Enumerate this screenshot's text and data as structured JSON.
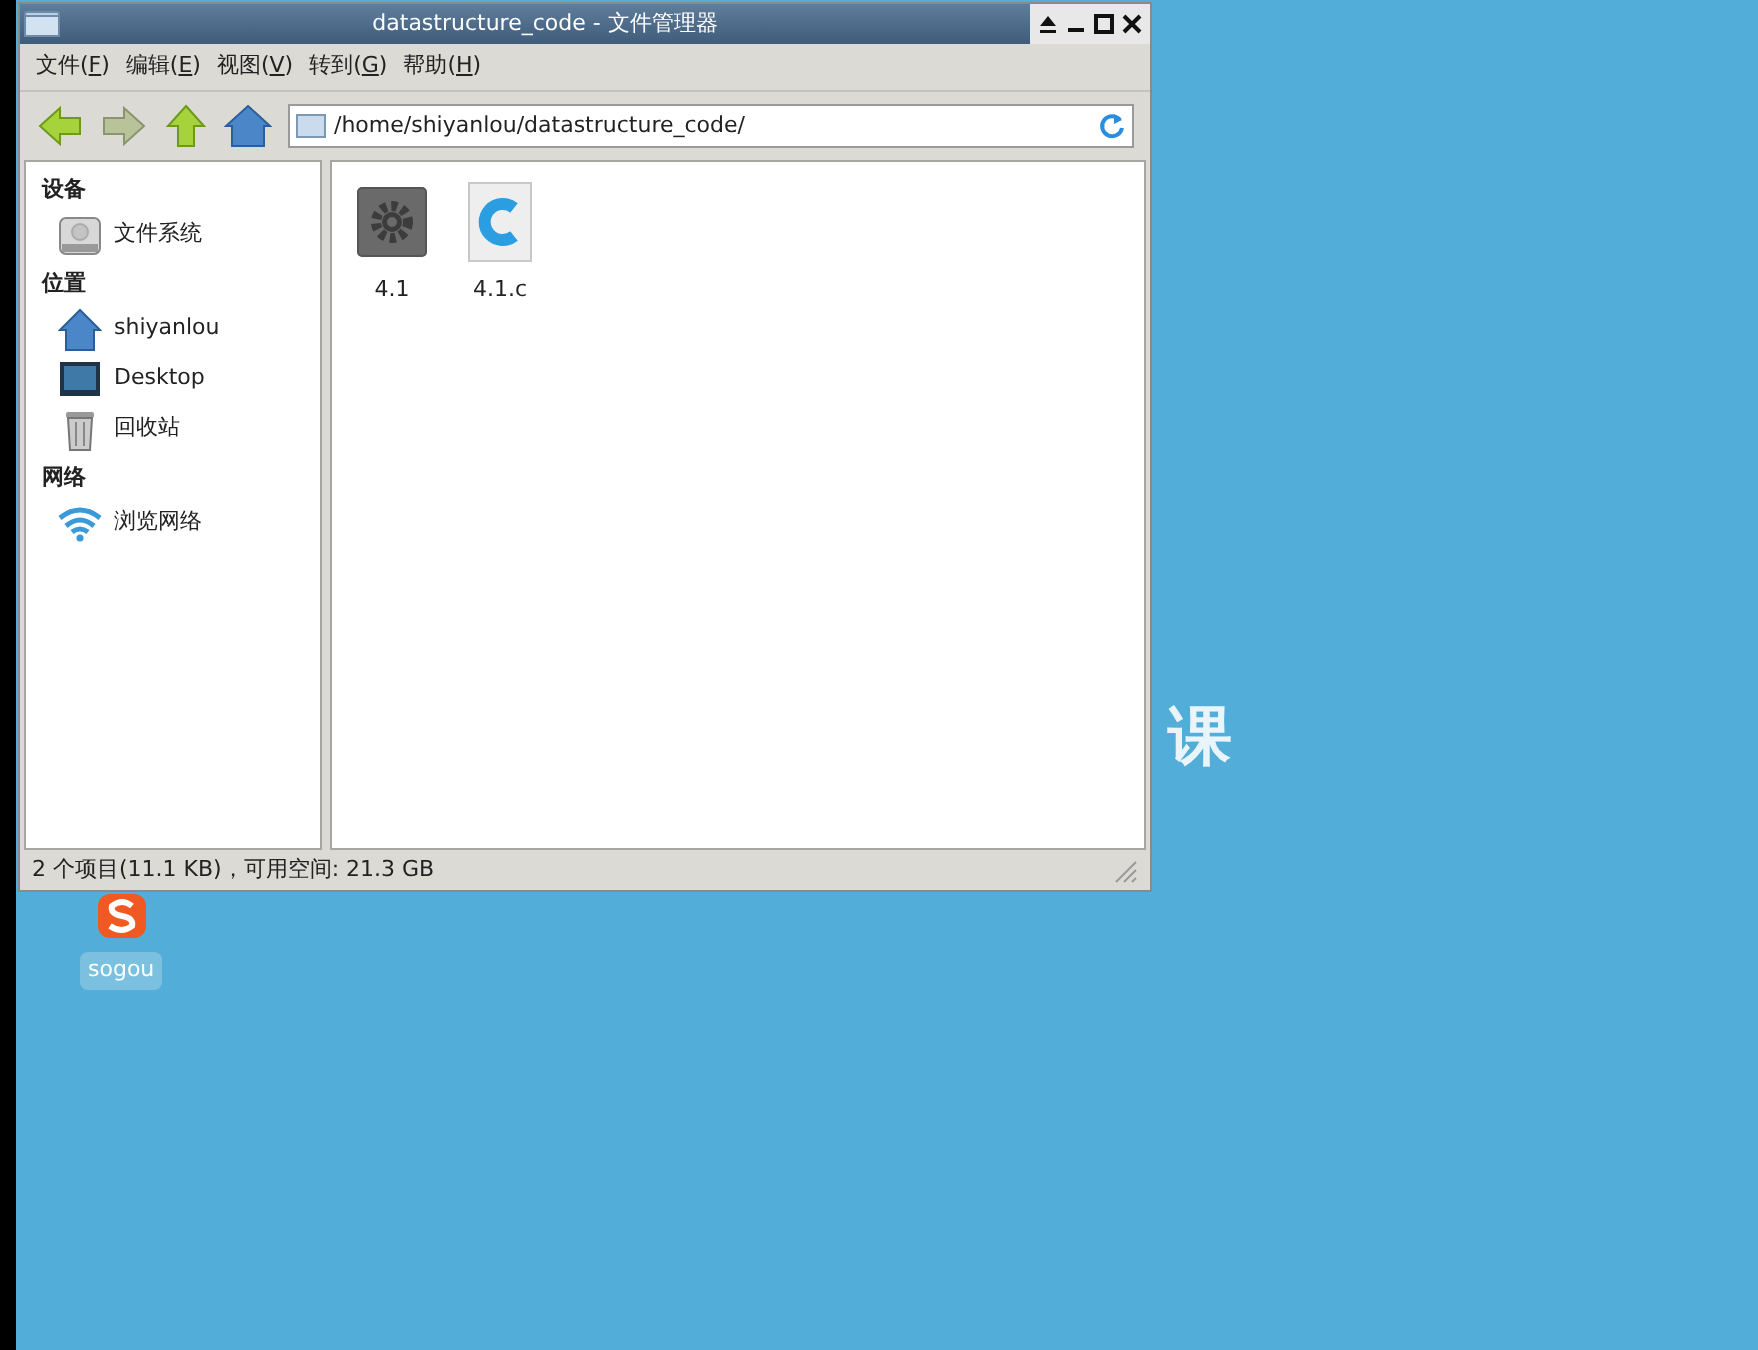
{
  "window": {
    "title": "datastructure_code - 文件管理器"
  },
  "menu": [
    {
      "before": "文件(",
      "key": "F",
      "after": ")"
    },
    {
      "before": "编辑(",
      "key": "E",
      "after": ")"
    },
    {
      "before": "视图(",
      "key": "V",
      "after": ")"
    },
    {
      "before": "转到(",
      "key": "G",
      "after": ")"
    },
    {
      "before": "帮助(",
      "key": "H",
      "after": ")"
    }
  ],
  "toolbar": [
    {
      "kind": "back",
      "disabled": false
    },
    {
      "kind": "forward",
      "disabled": true
    },
    {
      "kind": "up",
      "disabled": false
    },
    {
      "kind": "home",
      "disabled": false
    }
  ],
  "location": {
    "value": "/home/shiyanlou/datastructure_code/"
  },
  "sidebar": [
    {
      "heading": "设备",
      "items": [
        {
          "label": "文件系统",
          "kind": "drive"
        }
      ]
    },
    {
      "heading": "位置",
      "items": [
        {
          "label": "shiyanlou",
          "kind": "home"
        },
        {
          "label": "Desktop",
          "kind": "desktop"
        },
        {
          "label": "回收站",
          "kind": "trash"
        }
      ]
    },
    {
      "heading": "网络",
      "items": [
        {
          "label": "浏览网络",
          "kind": "network"
        }
      ]
    }
  ],
  "files": [
    {
      "name": "4.1",
      "kind": "executable"
    },
    {
      "name": "4.1.c",
      "kind": "csource"
    }
  ],
  "status_bar": "2 个项目(11.1 KB)，可用空间: 21.3 GB",
  "desktop": {
    "wallpaper_text": "课",
    "icons": [
      {
        "label": "sogou"
      }
    ]
  }
}
